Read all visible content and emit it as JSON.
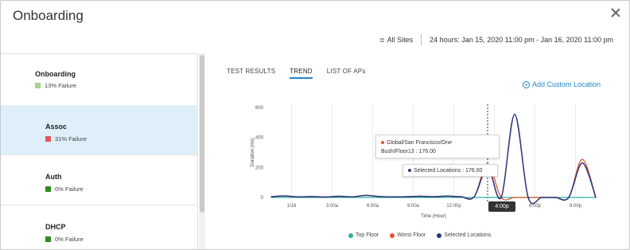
{
  "dialog": {
    "title": "Onboarding"
  },
  "filter": {
    "sites": "All Sites",
    "range": "24 hours: Jan 15, 2020 11:00 pm - Jan 16, 2020 11:00 pm"
  },
  "sidebar": {
    "items": [
      {
        "label": "Onboarding",
        "status": "13% Failure",
        "color": "#9fd88a",
        "active": false
      },
      {
        "label": "Assoc",
        "status": "31% Failure",
        "color": "#e05a5a",
        "active": true
      },
      {
        "label": "Auth",
        "status": "0% Failure",
        "color": "#2e8b1e",
        "active": false
      },
      {
        "label": "DHCP",
        "status": "0% Failure",
        "color": "#2e8b1e",
        "active": false
      }
    ]
  },
  "tabs": [
    {
      "label": "TEST RESULTS",
      "active": false
    },
    {
      "label": "TREND",
      "active": true
    },
    {
      "label": "LIST OF APs",
      "active": false
    }
  ],
  "add_location": "Add Custom Location",
  "tooltip": {
    "line1": "Global/San Francisco/One",
    "line2": "Bush/Floor13 : 176.00",
    "selected": "Selected Locations : 176.00"
  },
  "hover_x_label": "4:00p",
  "chart_data": {
    "type": "line",
    "ylabel": "Duration (ms)",
    "xlabel": "Time (Hour)",
    "ylim": [
      0,
      600
    ],
    "yticks": [
      "600",
      "400",
      "200",
      "0"
    ],
    "xticks": [
      "1/16",
      "3:00a",
      "6:00a",
      "9:00a",
      "12:00p",
      "3:00p",
      "6:00p",
      "9:00p"
    ],
    "x_hours": [
      0,
      1,
      2,
      3,
      4,
      5,
      6,
      7,
      8,
      9,
      10,
      11,
      12,
      13,
      14,
      15,
      16,
      17,
      18,
      19,
      20,
      21,
      22,
      23,
      24
    ],
    "series": [
      {
        "name": "Top Floor",
        "color": "#2bb0a0",
        "values": [
          0,
          0,
          0,
          0,
          0,
          0,
          0,
          0,
          0,
          0,
          0,
          0,
          0,
          0,
          0,
          0,
          0,
          0,
          0,
          0,
          0,
          0,
          0,
          0,
          0
        ]
      },
      {
        "name": "Worst Floor",
        "color": "#e0552f",
        "values": [
          5,
          10,
          4,
          6,
          3,
          8,
          4,
          14,
          6,
          4,
          5,
          8,
          5,
          9,
          5,
          4,
          225,
          0,
          0,
          0,
          0,
          0,
          0,
          255,
          0
        ]
      },
      {
        "name": "Selected Locations",
        "color": "#2b3478",
        "values": [
          5,
          10,
          4,
          6,
          3,
          8,
          4,
          14,
          6,
          4,
          5,
          8,
          5,
          9,
          5,
          4,
          200,
          0,
          555,
          0,
          0,
          0,
          0,
          230,
          0
        ]
      }
    ],
    "hover_x": 16,
    "grid": "vertical"
  }
}
